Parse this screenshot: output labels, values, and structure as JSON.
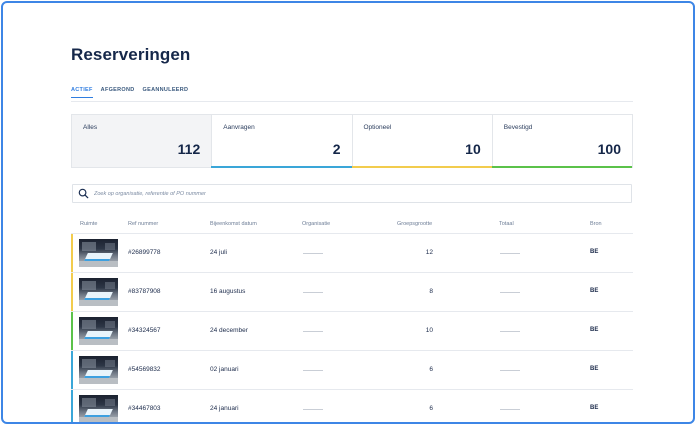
{
  "page": {
    "title": "Reserveringen"
  },
  "tabs": [
    {
      "label": "ACTIEF",
      "active": true
    },
    {
      "label": "AFGEROND",
      "active": false
    },
    {
      "label": "GEANNULEERD",
      "active": false
    }
  ],
  "summary": [
    {
      "label": "Alles",
      "count": "112",
      "accent": "",
      "selected": true
    },
    {
      "label": "Aanvragen",
      "count": "2",
      "accent": "#3aa6d8",
      "selected": false
    },
    {
      "label": "Optioneel",
      "count": "10",
      "accent": "#f2cc4d",
      "selected": false
    },
    {
      "label": "Bevestigd",
      "count": "100",
      "accent": "#5bc24a",
      "selected": false
    }
  ],
  "search": {
    "placeholder": "Zoek op organisatie, referentie of PO nummer",
    "value": ""
  },
  "table": {
    "columns": [
      "Ruimte",
      "Ref nummer",
      "Bijeenkomst datum",
      "Organisatie",
      "Groepsgrootte",
      "Totaal",
      "Bron"
    ],
    "rows": [
      {
        "ref": "#26899778",
        "date": "24 juli",
        "size": "12",
        "source": "BE",
        "accent": "#f2cc4d"
      },
      {
        "ref": "#83787908",
        "date": "16 augustus",
        "size": "8",
        "source": "BE",
        "accent": "#f2cc4d"
      },
      {
        "ref": "#34324567",
        "date": "24 december",
        "size": "10",
        "source": "BE",
        "accent": "#5bc24a"
      },
      {
        "ref": "#54569832",
        "date": "02 januari",
        "size": "6",
        "source": "BE",
        "accent": "#3aa6d8"
      },
      {
        "ref": "#34467803",
        "date": "24 januari",
        "size": "6",
        "source": "BE",
        "accent": "#3aa6d8"
      }
    ]
  },
  "icons": {
    "search": "search-icon",
    "room_photo": "room-thumbnail"
  }
}
